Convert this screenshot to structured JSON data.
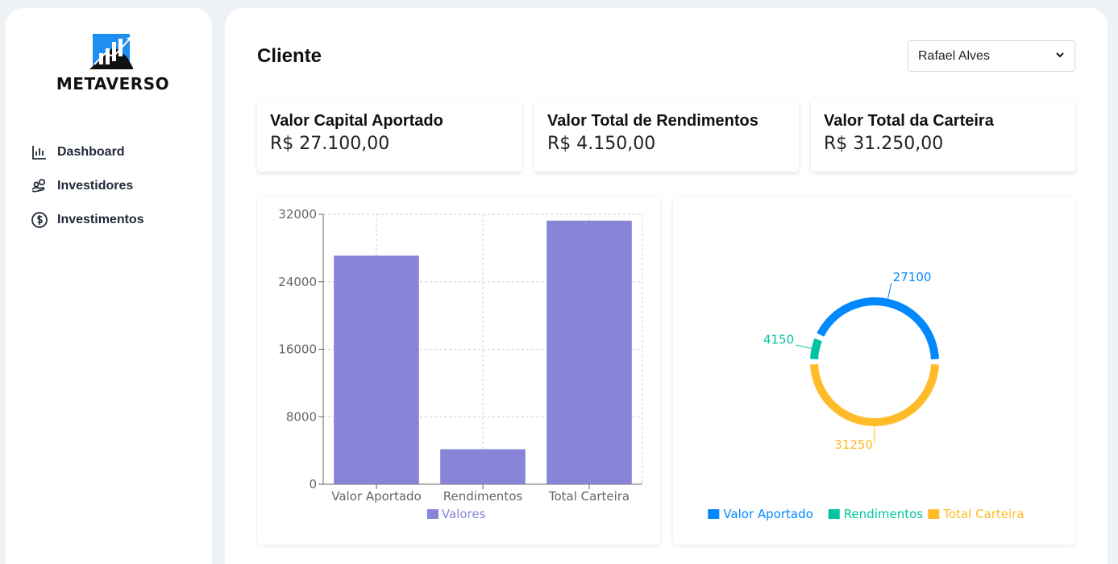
{
  "brand": {
    "logo_text": "METAVERSO"
  },
  "sidebar": {
    "items": [
      {
        "label": "Dashboard",
        "icon": "bar-chart-icon"
      },
      {
        "label": "Investidores",
        "icon": "hand-coins-icon"
      },
      {
        "label": "Investimentos",
        "icon": "dollar-circle-icon"
      }
    ]
  },
  "header": {
    "title": "Cliente"
  },
  "client_select": {
    "selected": "Rafael Alves"
  },
  "cards": [
    {
      "title": "Valor Capital Aportado",
      "value": "R$ 27.100,00"
    },
    {
      "title": "Valor Total de Rendimentos",
      "value": "R$ 4.150,00"
    },
    {
      "title": "Valor Total da Carteira",
      "value": "R$ 31.250,00"
    }
  ],
  "colors": {
    "bar": "#8884d8",
    "aportado": "#0088fe",
    "rendimentos": "#00c49f",
    "carteira": "#ffbb28"
  },
  "chart_data": [
    {
      "type": "bar",
      "categories": [
        "Valor Aportado",
        "Rendimentos",
        "Total Carteira"
      ],
      "series": [
        {
          "name": "Valores",
          "values": [
            27100,
            4150,
            31250
          ]
        }
      ],
      "yticks": [
        "0",
        "8000",
        "16000",
        "24000",
        "32000"
      ],
      "ylim": [
        0,
        32000
      ],
      "grid": true,
      "legend": "bottom"
    },
    {
      "type": "pie",
      "labels": [
        "Valor Aportado",
        "Rendimentos",
        "Total Carteira"
      ],
      "values": [
        27100,
        4150,
        31250
      ],
      "data_labels": [
        "27100",
        "4150",
        "31250"
      ],
      "legend": "bottom"
    }
  ]
}
